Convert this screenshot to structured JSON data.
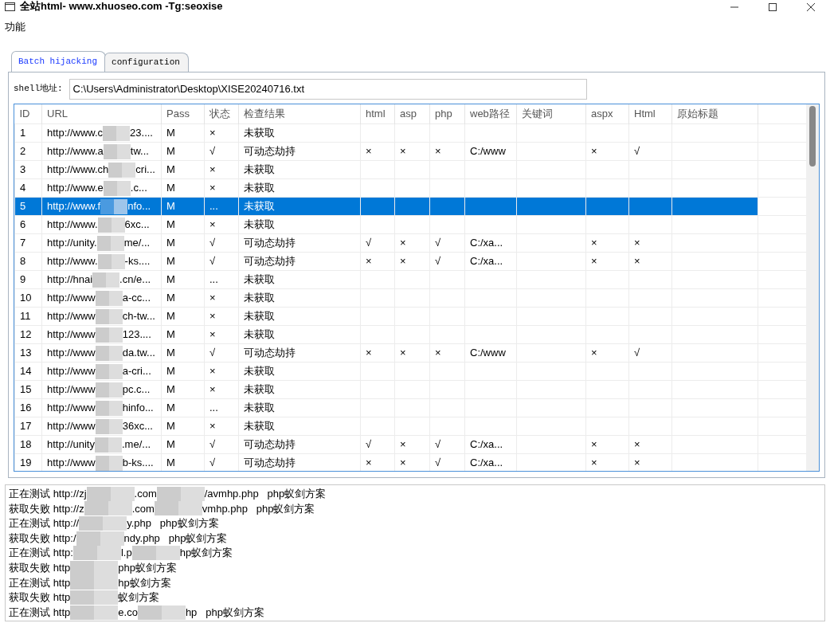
{
  "window": {
    "title": "全站html- www.xhuoseo.com -Tg:seoxise"
  },
  "menu": [
    {
      "label": "功能"
    }
  ],
  "tabs": [
    {
      "label": "Batch hijacking",
      "selected": true
    },
    {
      "label": "configuration",
      "selected": false
    }
  ],
  "shell_field": {
    "label": "shell地址:",
    "value": "C:\\Users\\Administrator\\Desktop\\XISE20240716.txt"
  },
  "table": {
    "columns": [
      "ID",
      "URL",
      "Pass",
      "状态",
      "检查结果",
      "html",
      "asp",
      "php",
      "web路径",
      "关键词",
      "aspx",
      "Html",
      "原始标题"
    ],
    "rows": [
      {
        "id": "1",
        "url": [
          "http://www.c",
          "23...."
        ],
        "pass": "M",
        "status": "×",
        "result": "未获取",
        "selected": false
      },
      {
        "id": "2",
        "url": [
          "http://www.a",
          "tw..."
        ],
        "pass": "M",
        "status": "√",
        "result": "可动态劫持",
        "html": "×",
        "asp": "×",
        "php": "×",
        "web_path": "C:/www",
        "aspx": "×",
        "html_upper": "√",
        "selected": false
      },
      {
        "id": "3",
        "url": [
          "http://www.ch",
          "cri..."
        ],
        "pass": "M",
        "status": "×",
        "result": "未获取",
        "selected": false
      },
      {
        "id": "4",
        "url": [
          "http://www.e",
          ".c..."
        ],
        "pass": "M",
        "status": "×",
        "result": "未获取",
        "selected": false
      },
      {
        "id": "5",
        "url": [
          "http://www.f",
          "nfo..."
        ],
        "pass": "M",
        "status": "...",
        "result": "未获取",
        "selected": true
      },
      {
        "id": "6",
        "url": [
          "http://www.",
          "6xc..."
        ],
        "pass": "M",
        "status": "×",
        "result": "未获取",
        "selected": false
      },
      {
        "id": "7",
        "url": [
          "http://unity.",
          "me/..."
        ],
        "pass": "M",
        "status": "√",
        "result": "可动态劫持",
        "html": "√",
        "asp": "×",
        "php": "√",
        "web_path": "C:/xa...",
        "aspx": "×",
        "html_upper": "×",
        "selected": false
      },
      {
        "id": "8",
        "url": [
          "http://www.",
          "-ks...."
        ],
        "pass": "M",
        "status": "√",
        "result": "可动态劫持",
        "html": "×",
        "asp": "×",
        "php": "√",
        "web_path": "C:/xa...",
        "aspx": "×",
        "html_upper": "×",
        "selected": false
      },
      {
        "id": "9",
        "url": [
          "http://hnai",
          ".cn/e..."
        ],
        "pass": "M",
        "status": "...",
        "result": "未获取",
        "selected": false
      },
      {
        "id": "10",
        "url": [
          "http://www",
          "a-cc..."
        ],
        "pass": "M",
        "status": "×",
        "result": "未获取",
        "selected": false
      },
      {
        "id": "11",
        "url": [
          "http://www",
          "ch-tw..."
        ],
        "pass": "M",
        "status": "×",
        "result": "未获取",
        "selected": false
      },
      {
        "id": "12",
        "url": [
          "http://www",
          "123...."
        ],
        "pass": "M",
        "status": "×",
        "result": "未获取",
        "selected": false
      },
      {
        "id": "13",
        "url": [
          "http://www",
          "da.tw..."
        ],
        "pass": "M",
        "status": "√",
        "result": "可动态劫持",
        "html": "×",
        "asp": "×",
        "php": "×",
        "web_path": "C:/www",
        "aspx": "×",
        "html_upper": "√",
        "selected": false
      },
      {
        "id": "14",
        "url": [
          "http://www",
          "a-cri..."
        ],
        "pass": "M",
        "status": "×",
        "result": "未获取",
        "selected": false
      },
      {
        "id": "15",
        "url": [
          "http://www",
          "pc.c..."
        ],
        "pass": "M",
        "status": "×",
        "result": "未获取",
        "selected": false
      },
      {
        "id": "16",
        "url": [
          "http://www",
          "hinfo..."
        ],
        "pass": "M",
        "status": "...",
        "result": "未获取",
        "selected": false
      },
      {
        "id": "17",
        "url": [
          "http://www",
          "36xc..."
        ],
        "pass": "M",
        "status": "×",
        "result": "未获取",
        "selected": false
      },
      {
        "id": "18",
        "url": [
          "http://unity",
          ".me/..."
        ],
        "pass": "M",
        "status": "√",
        "result": "可动态劫持",
        "html": "√",
        "asp": "×",
        "php": "√",
        "web_path": "C:/xa...",
        "aspx": "×",
        "html_upper": "×",
        "selected": false
      },
      {
        "id": "19",
        "url": [
          "http://www",
          "b-ks...."
        ],
        "pass": "M",
        "status": "√",
        "result": "可动态劫持",
        "html": "×",
        "asp": "×",
        "php": "√",
        "web_path": "C:/xa...",
        "aspx": "×",
        "html_upper": "×",
        "selected": false
      }
    ]
  },
  "log": [
    {
      "status": "正在测试",
      "fragments": [
        "http://zj",
        ".com",
        "/avmhp.php   php蚁剑方案"
      ]
    },
    {
      "status": "获取失败",
      "fragments": [
        "http://z",
        ".com",
        "vmhp.php   php蚁剑方案"
      ]
    },
    {
      "status": "正在测试",
      "fragments": [
        "http://",
        "y.php   php蚁剑方案"
      ]
    },
    {
      "status": "获取失败",
      "fragments": [
        "http:/",
        "ndy.php   php蚁剑方案"
      ]
    },
    {
      "status": "正在测试",
      "fragments": [
        "http:",
        "l.p",
        "hp蚁剑方案"
      ]
    },
    {
      "status": "获取失败",
      "fragments": [
        "http",
        "php蚁剑方案"
      ]
    },
    {
      "status": "正在测试",
      "fragments": [
        "http",
        "hp蚁剑方案"
      ]
    },
    {
      "status": "获取失败",
      "fragments": [
        "http",
        "蚁剑方案"
      ]
    },
    {
      "status": "正在测试",
      "fragments": [
        "http",
        "e.co",
        "hp   php蚁剑方案"
      ]
    }
  ]
}
